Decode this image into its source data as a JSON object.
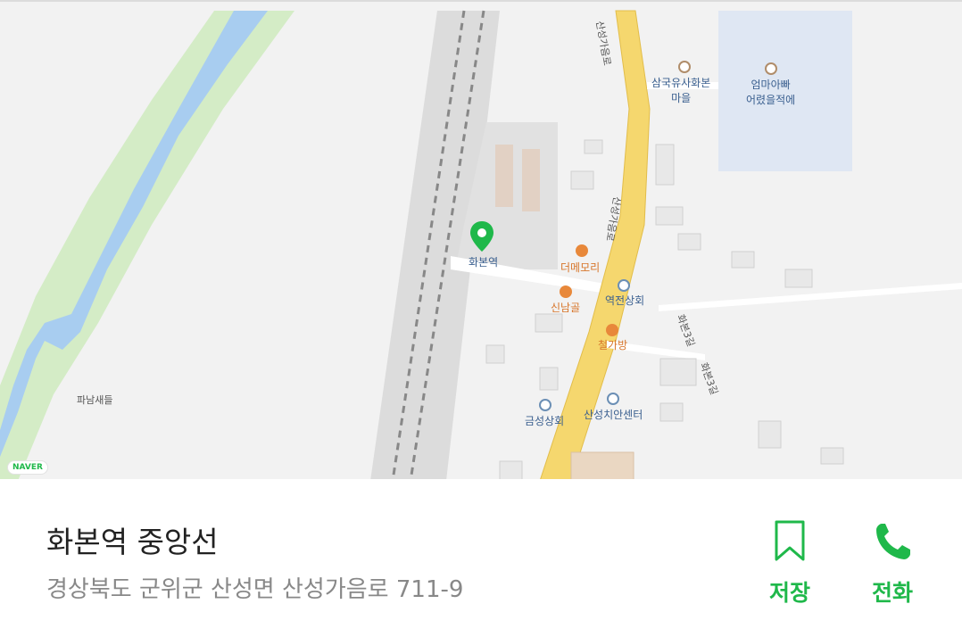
{
  "map": {
    "labels": {
      "samguk": "삼국유사화본\n마을",
      "eomma": "엄마아빠\n어렸을적에",
      "station": "화본역",
      "themory": "더메모리",
      "sinnamgol": "신남골",
      "yeokjeon": "역전상회",
      "cheolgabang": "철가방",
      "geumseong": "금성상회",
      "chian": "산성치안센터",
      "panam": "파남새들",
      "road_sanseong": "산성가음로",
      "road_hwabon3": "화본3길",
      "road_hwabon3b": "화본3길"
    },
    "brand": "NAVER",
    "colors": {
      "road": "#f5d76e",
      "water": "#a8cdf0",
      "green": "#d4ecc6",
      "pin": "#1fb84a"
    }
  },
  "place": {
    "title": "화본역 중앙선",
    "address": "경상북도 군위군 산성면 산성가음로 711-9"
  },
  "actions": {
    "save": {
      "label": "저장",
      "icon": "bookmark-icon"
    },
    "call": {
      "label": "전화",
      "icon": "phone-icon"
    }
  },
  "accent": "#1fb84a"
}
